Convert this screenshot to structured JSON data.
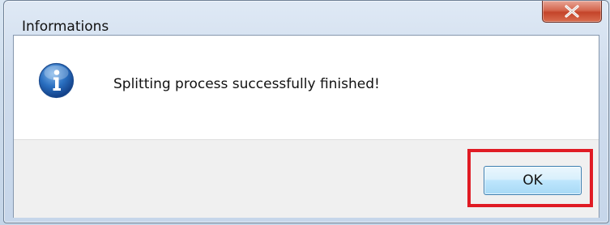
{
  "window": {
    "title": "Informations",
    "close_icon": "close-icon"
  },
  "message": {
    "icon": "info-icon",
    "text": "Splitting process successfully finished!"
  },
  "buttons": {
    "ok_label": "OK"
  },
  "colors": {
    "highlight": "#e01b24",
    "close_button": "#c4442a",
    "ok_button_border": "#3c7fb1"
  }
}
